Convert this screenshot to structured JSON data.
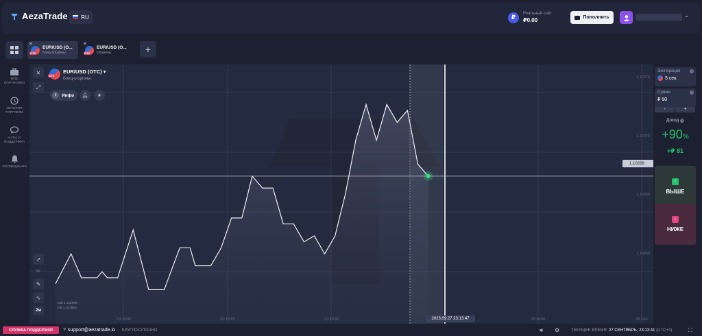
{
  "header": {
    "logo_text": "AezaTrade",
    "language": "RU",
    "account_label": "Реальный счёт",
    "account_balance": "₽0.00",
    "currency_symbol": "₽",
    "deposit_label": "Пополнить"
  },
  "tabs": [
    {
      "name": "EUR/USD (O...",
      "type": "Блиц-опционы",
      "active": true
    },
    {
      "name": "EUR/USD (O...",
      "type": "Опционы",
      "active": false
    }
  ],
  "sidebar": {
    "items": [
      {
        "label_1": "МОЕ",
        "label_2": "ПОРТФОЛИО",
        "icon": "briefcase-icon"
      },
      {
        "label_1": "ИСТОРИЯ",
        "label_2": "ТОРГОВЛИ",
        "icon": "history-icon"
      },
      {
        "label_1": "ЧАТЫ И",
        "label_2": "ПОДДЕРЖКА",
        "icon": "chat-icon"
      },
      {
        "label_1": "ОПОВЕЩЕНИЯ",
        "label_2": "",
        "icon": "bell-icon"
      }
    ]
  },
  "chart": {
    "asset_name": "EUR/USD (OTC)",
    "asset_type": "Блиц-опционы",
    "otc_badge": "OTC",
    "info_label": "Инфо",
    "timeframe": "2м",
    "tf_secondary": "5с",
    "ask": "ask 1.102690",
    "bid": "bid 1.102660",
    "current_price": "1.10268",
    "time_marker": "2023.09.27 23:13:47",
    "price_ticks": [
      "1.10275",
      "1.10270",
      "1.10265",
      "1.10260"
    ],
    "time_ticks": [
      "23:13:00",
      "23:13:15",
      "23:13:30",
      "23:14:00",
      "23:14:1"
    ]
  },
  "chart_data": {
    "type": "area",
    "x_label": "",
    "y_label": "",
    "y_range": [
      1.10256,
      1.10277
    ],
    "points": [
      {
        "t": 0,
        "v": 1.10259
      },
      {
        "t": 1.5,
        "v": 1.102615
      },
      {
        "t": 2.5,
        "v": 1.102595
      },
      {
        "t": 4,
        "v": 1.102595
      },
      {
        "t": 4.5,
        "v": 1.1026
      },
      {
        "t": 5,
        "v": 1.102595
      },
      {
        "t": 6,
        "v": 1.102595
      },
      {
        "t": 7.5,
        "v": 1.102635
      },
      {
        "t": 9,
        "v": 1.102585
      },
      {
        "t": 10.5,
        "v": 1.102585
      },
      {
        "t": 12,
        "v": 1.10262
      },
      {
        "t": 13,
        "v": 1.10262
      },
      {
        "t": 13.5,
        "v": 1.102605
      },
      {
        "t": 15,
        "v": 1.102605
      },
      {
        "t": 16,
        "v": 1.10262
      },
      {
        "t": 17,
        "v": 1.102645
      },
      {
        "t": 18,
        "v": 1.102645
      },
      {
        "t": 19,
        "v": 1.10268
      },
      {
        "t": 20,
        "v": 1.10267
      },
      {
        "t": 21,
        "v": 1.10267
      },
      {
        "t": 22,
        "v": 1.10264
      },
      {
        "t": 23,
        "v": 1.10264
      },
      {
        "t": 24,
        "v": 1.102625
      },
      {
        "t": 25,
        "v": 1.10263
      },
      {
        "t": 26,
        "v": 1.102615
      },
      {
        "t": 27,
        "v": 1.10263
      },
      {
        "t": 28,
        "v": 1.102665
      },
      {
        "t": 29,
        "v": 1.10271
      },
      {
        "t": 30,
        "v": 1.10274
      },
      {
        "t": 31,
        "v": 1.10271
      },
      {
        "t": 32,
        "v": 1.10274
      },
      {
        "t": 33,
        "v": 1.102725
      },
      {
        "t": 34,
        "v": 1.102735
      },
      {
        "t": 35,
        "v": 1.10269
      },
      {
        "t": 36,
        "v": 1.10268
      }
    ],
    "current_value": 1.10268
  },
  "panel": {
    "expiration_label": "Экспирация",
    "expiration_value": "5 сек.",
    "amount_label": "Сумма",
    "amount_value": "₽ 90",
    "minus": "-",
    "plus": "+",
    "income_label": "Доход",
    "income_pct": "+90",
    "income_pct_sign": "%",
    "income_amount": "+₽ 81",
    "up_label": "ВЫШЕ",
    "down_label": "НИЖЕ",
    "up_color": "#26c26b",
    "down_color": "#e3457a"
  },
  "footer": {
    "support_label": "СЛУЖБА ПОДДЕРЖКИ",
    "support_email": "support@aezatrade.io",
    "support_hours": "КРУГЛОСУТОЧНО",
    "time_label": "ТЕКУЩЕЕ ВРЕМЯ:",
    "time_value": "27 СЕНТЯБРЬ, 23:13:41",
    "timezone": "(UTC+3)"
  }
}
